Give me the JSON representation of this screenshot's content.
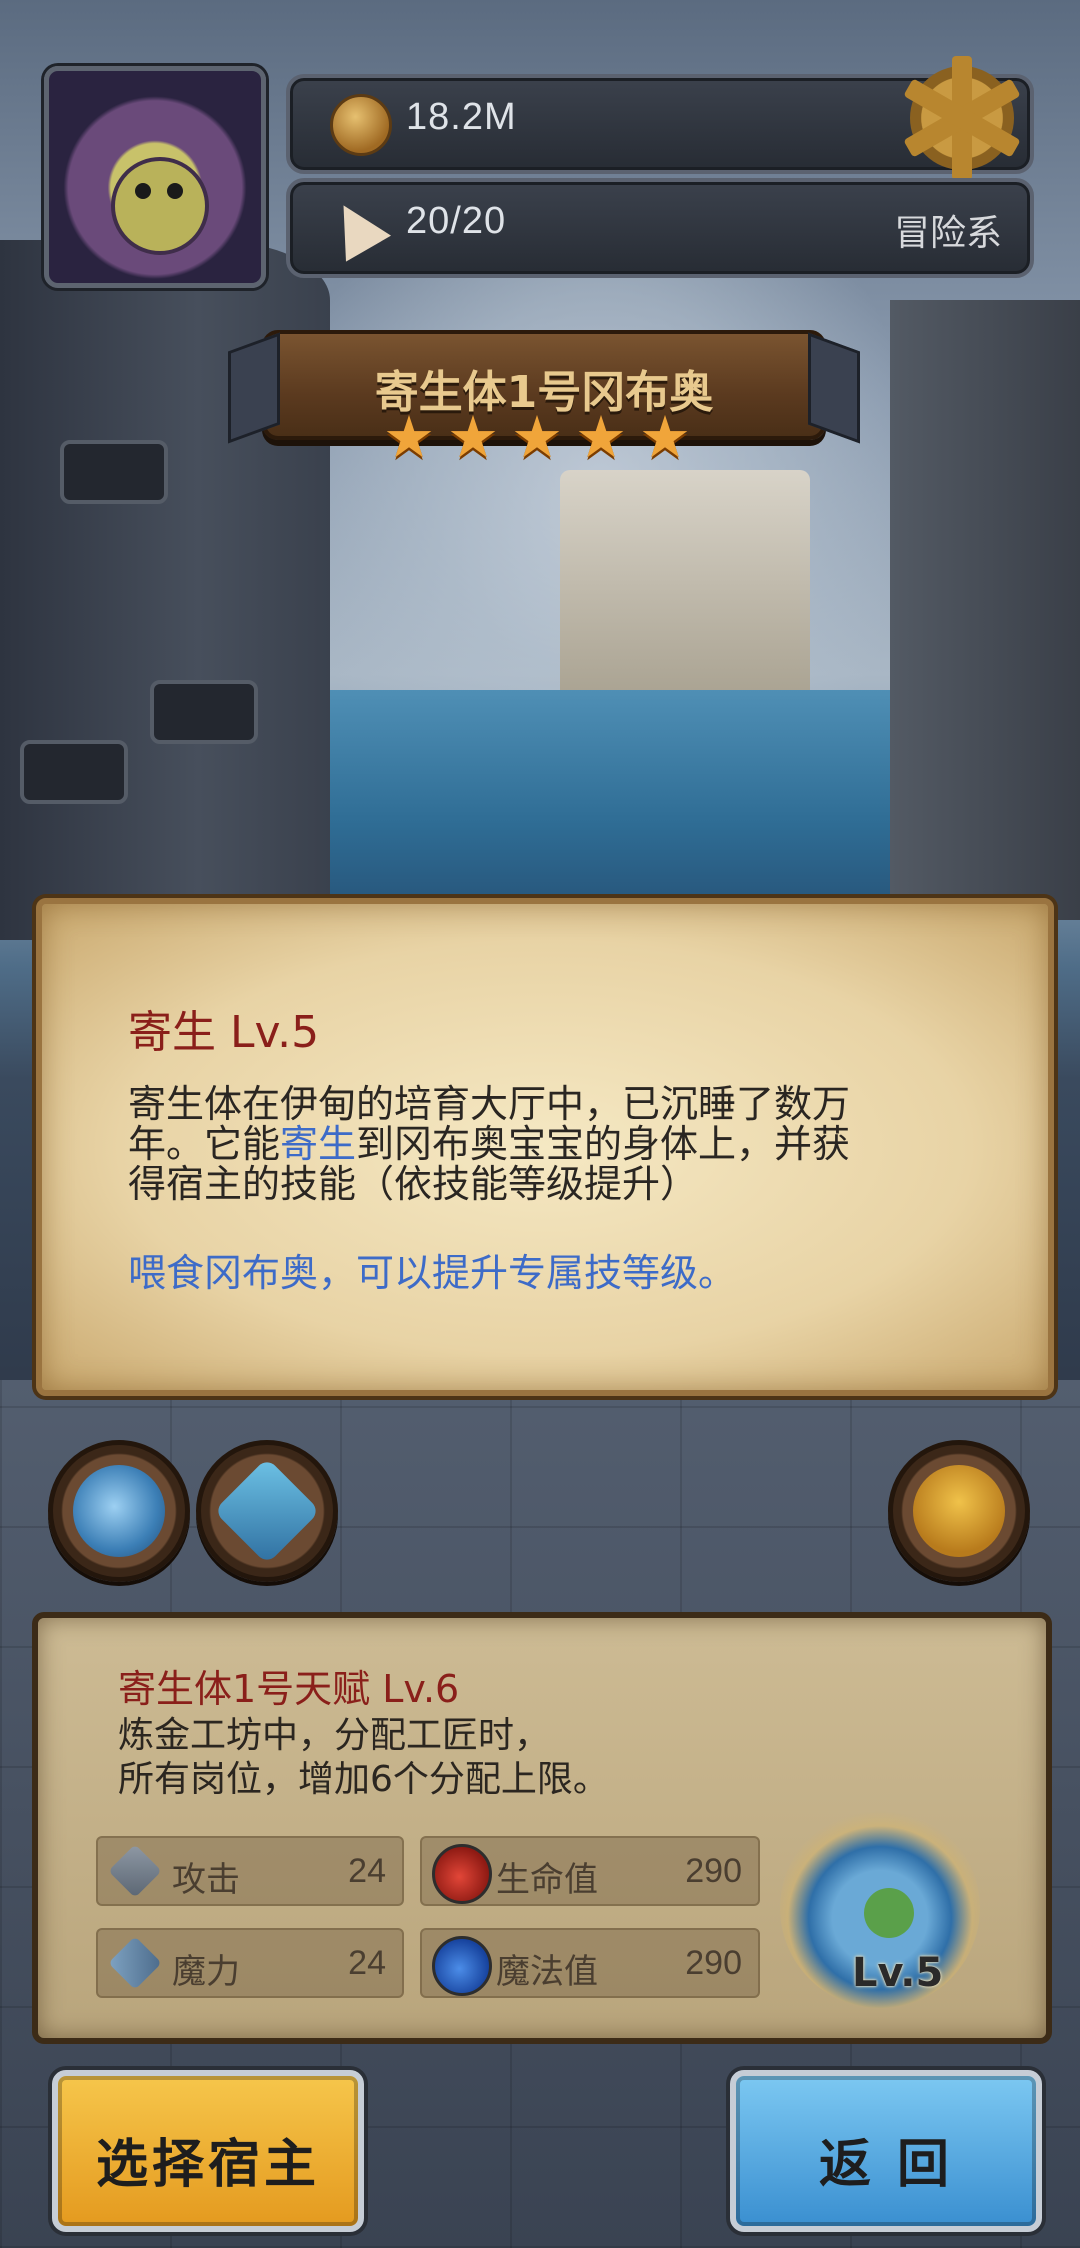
{
  "header": {
    "gold": "18.2M",
    "stamina": "20/20",
    "category": "冒险系"
  },
  "monster": {
    "name": "寄生体1号冈布奥",
    "stars": 5
  },
  "skill": {
    "title": "寄生 Lv.5",
    "desc_line1": "寄生体在伊甸的培育大厅中，已沉睡了数万",
    "desc_line2_a": "年。它能",
    "desc_line2_hl": "寄生",
    "desc_line2_b": "到冈布奥宝宝的身体上，并获",
    "desc_line3": "得宿主的技能（依技能等级提升）",
    "hint": "喂食冈布奥，可以提升专属技等级。"
  },
  "talent": {
    "title": "寄生体1号天赋 Lv.6",
    "desc_line1": "炼金工坊中，分配工匠时，",
    "desc_line2": "所有岗位，增加6个分配上限。",
    "stats": [
      {
        "label": "攻击",
        "value": "24",
        "icon": "sword-icon"
      },
      {
        "label": "生命值",
        "value": "290",
        "icon": "red-potion-icon"
      },
      {
        "label": "魔力",
        "value": "24",
        "icon": "wand-icon"
      },
      {
        "label": "魔法值",
        "value": "290",
        "icon": "blue-potion-icon"
      }
    ],
    "pet_level": "Lv.5"
  },
  "buttons": {
    "select_host": "选择宿主",
    "back": "返 回"
  },
  "colors": {
    "skill_title": "#8a1f1a",
    "highlight": "#3d6bc8",
    "star": "#f0a53a"
  }
}
